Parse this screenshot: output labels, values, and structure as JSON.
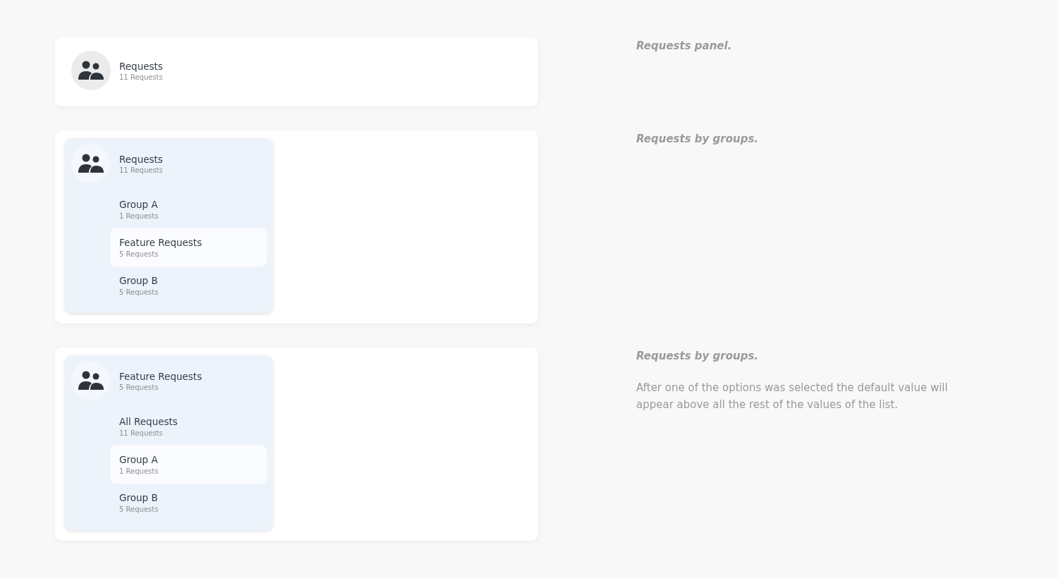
{
  "sections": [
    {
      "panel": {
        "expanded": false,
        "title": "Requests",
        "count": "11 Requests"
      },
      "notes": [
        {
          "kind": "caption",
          "text": "Requests panel."
        }
      ]
    },
    {
      "panel": {
        "expanded": true,
        "title": "Requests",
        "count": "11 Requests",
        "options": [
          {
            "title": "Group A",
            "count": "1 Requests",
            "highlighted": false
          },
          {
            "title": "Feature Requests",
            "count": "5 Requests",
            "highlighted": true
          },
          {
            "title": "Group B",
            "count": "5 Requests",
            "highlighted": false
          }
        ]
      },
      "notes": [
        {
          "kind": "caption",
          "text": "Requests by groups."
        }
      ]
    },
    {
      "panel": {
        "expanded": true,
        "title": "Feature Requests",
        "count": "5 Requests",
        "options": [
          {
            "title": "All Requests",
            "count": "11 Requests",
            "highlighted": false
          },
          {
            "title": "Group A",
            "count": "1 Requests",
            "highlighted": true
          },
          {
            "title": "Group B",
            "count": "5 Requests",
            "highlighted": false
          }
        ]
      },
      "notes": [
        {
          "kind": "caption",
          "text": "Requests by groups."
        },
        {
          "kind": "body",
          "text": "After one of the options was selected the default value will appear above all the rest of the values of the list."
        }
      ]
    }
  ]
}
